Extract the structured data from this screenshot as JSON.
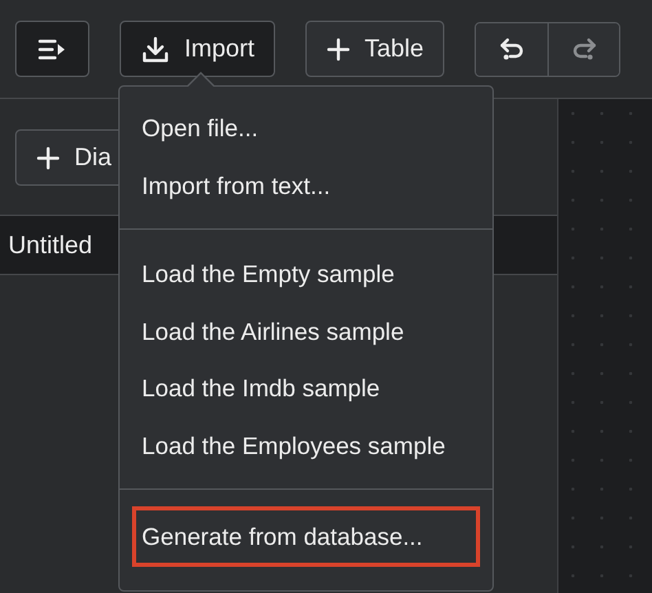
{
  "toolbar": {
    "buttons": [
      {
        "kind": "menu"
      },
      {
        "kind": "import",
        "label": "Import",
        "selected": true
      },
      {
        "kind": "table",
        "label": "Table",
        "selected": false
      }
    ],
    "history": [
      {
        "kind": "undo",
        "disabled": false
      },
      {
        "kind": "redo",
        "disabled": true
      }
    ]
  },
  "sidebar": {
    "new_button": "Dia",
    "rows": [
      {
        "label": "Untitled",
        "selected": true
      }
    ]
  },
  "import_menu": {
    "groups": [
      [
        {
          "label": "Open file...",
          "highlighted": false
        },
        {
          "label": "Import from text...",
          "highlighted": false
        }
      ],
      [
        {
          "label": "Load the Empty sample",
          "highlighted": false
        },
        {
          "label": "Load the Airlines sample",
          "highlighted": false
        },
        {
          "label": "Load the Imdb sample",
          "highlighted": false
        },
        {
          "label": "Load the Employees sample",
          "highlighted": false
        }
      ],
      [
        {
          "label": "Generate from database...",
          "highlighted": true
        }
      ]
    ]
  }
}
